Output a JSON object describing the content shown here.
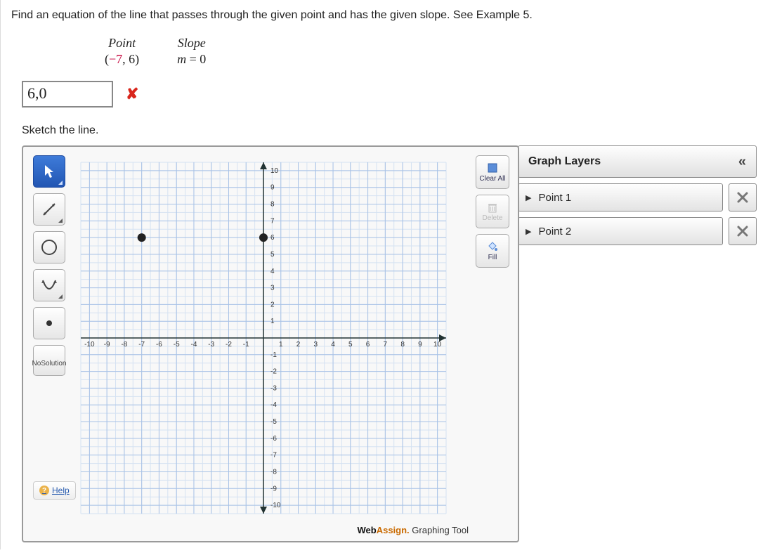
{
  "question": "Find an equation of the line that passes through the given point and has the given slope. See Example 5.",
  "headers": {
    "point": "Point",
    "slope": "Slope"
  },
  "values": {
    "point_prefix": "(",
    "point_neg": "−7",
    "point_suffix": ", 6)",
    "slope_lhs": "m",
    "slope_rhs": " = 0"
  },
  "answer_value": "6,0",
  "sketch_label": "Sketch the line.",
  "tools": {
    "no_solution_l1": "No",
    "no_solution_l2": "Solution",
    "help": "Help"
  },
  "right_tools": {
    "clear": "Clear All",
    "delete": "Delete",
    "fill": "Fill"
  },
  "footer": {
    "wa": "Web",
    "assign": "Assign.",
    "tool": " Graphing Tool"
  },
  "layers": {
    "title": "Graph Layers",
    "items": [
      "Point 1",
      "Point 2"
    ]
  },
  "chart_data": {
    "type": "scatter",
    "title": "",
    "xlabel": "",
    "ylabel": "",
    "xlim": [
      -10.5,
      10.5
    ],
    "ylim": [
      -10.5,
      10.5
    ],
    "xticks": [
      -10,
      -9,
      -8,
      -7,
      -6,
      -5,
      -4,
      -3,
      -2,
      -1,
      1,
      2,
      3,
      4,
      5,
      6,
      7,
      8,
      9,
      10
    ],
    "yticks": [
      -10,
      -9,
      -8,
      -7,
      -6,
      -5,
      -4,
      -3,
      -2,
      -1,
      1,
      2,
      3,
      4,
      5,
      6,
      7,
      8,
      9,
      10
    ],
    "grid": true,
    "series": [
      {
        "name": "Point 1",
        "x": [
          -7
        ],
        "y": [
          6
        ]
      },
      {
        "name": "Point 2",
        "x": [
          0
        ],
        "y": [
          6
        ]
      }
    ]
  }
}
